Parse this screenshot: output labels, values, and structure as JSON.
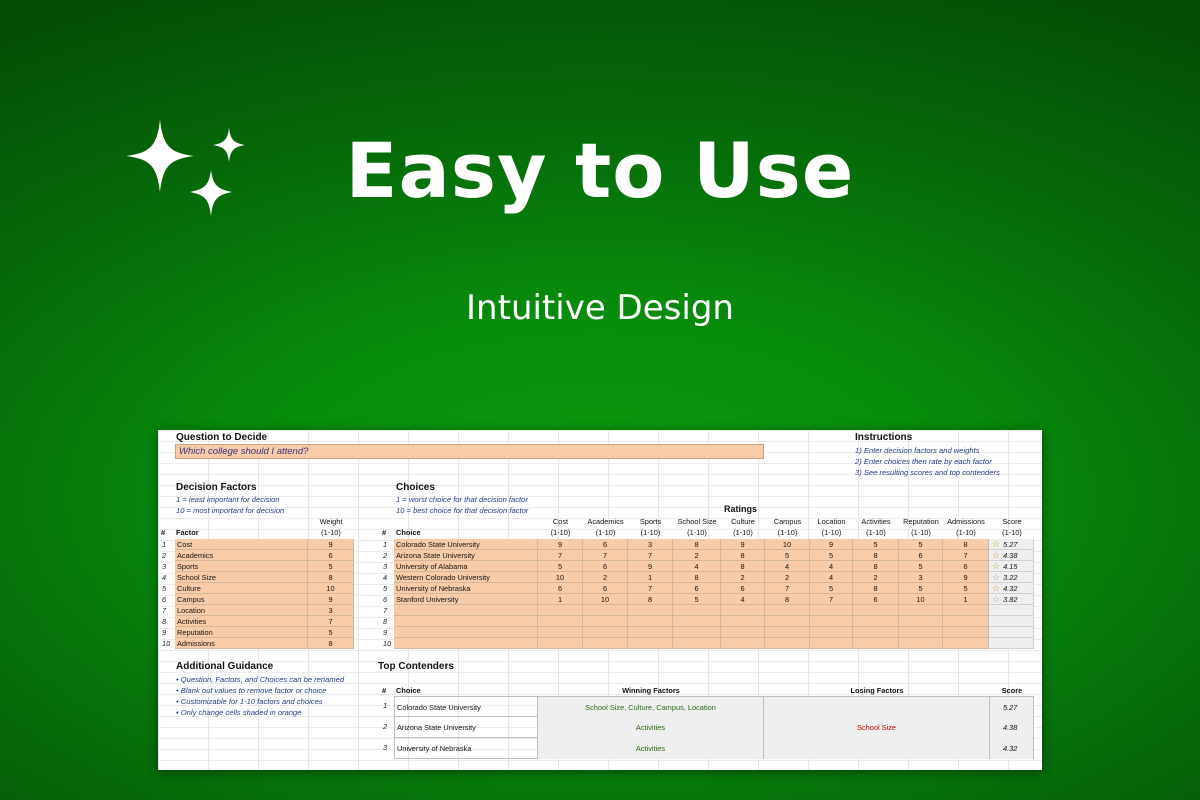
{
  "hero": {
    "title": "Easy to Use",
    "subtitle": "Intuitive Design",
    "icon": "sparkles-icon"
  },
  "question": {
    "heading": "Question to Decide",
    "value": "Which college should I attend?"
  },
  "instructions": {
    "heading": "Instructions",
    "steps": [
      "1) Enter decision factors and weights",
      "2) Enter choices then rate by each factor",
      "3) See resulting scores and top contenders"
    ]
  },
  "factors": {
    "heading": "Decision Factors",
    "notes": [
      "1 = least important for decision",
      "10 = most important for decision"
    ],
    "col_num": "#",
    "col_factor": "Factor",
    "col_weight_1": "Weight",
    "col_weight_2": "(1-10)",
    "rows": [
      {
        "n": "1",
        "name": "Cost",
        "weight": "9"
      },
      {
        "n": "2",
        "name": "Academics",
        "weight": "6"
      },
      {
        "n": "3",
        "name": "Sports",
        "weight": "5"
      },
      {
        "n": "4",
        "name": "School Size",
        "weight": "8"
      },
      {
        "n": "5",
        "name": "Culture",
        "weight": "10"
      },
      {
        "n": "6",
        "name": "Campus",
        "weight": "9"
      },
      {
        "n": "7",
        "name": "Location",
        "weight": "3"
      },
      {
        "n": "8",
        "name": "Activities",
        "weight": "7"
      },
      {
        "n": "9",
        "name": "Reputation",
        "weight": "5"
      },
      {
        "n": "10",
        "name": "Admissions",
        "weight": "8"
      }
    ]
  },
  "choices": {
    "heading": "Choices",
    "notes": [
      "1 = worst choice for that decision factor",
      "10 = best choice for that decision factor"
    ],
    "ratings_heading": "Ratings",
    "col_num": "#",
    "col_choice": "Choice",
    "factor_cols": [
      "Cost",
      "Academics",
      "Sports",
      "School Size",
      "Culture",
      "Campus",
      "Location",
      "Activities",
      "Reputation",
      "Admissions"
    ],
    "range_label": "(1-10)",
    "score_label": "Score",
    "score_range": "(1-10)",
    "rows": [
      {
        "n": "1",
        "name": "Colorado State University",
        "ratings": [
          "9",
          "6",
          "3",
          "8",
          "9",
          "10",
          "9",
          "5",
          "5",
          "8"
        ],
        "score": "5.27",
        "star": "gold"
      },
      {
        "n": "2",
        "name": "Arizona State University",
        "ratings": [
          "7",
          "7",
          "7",
          "2",
          "8",
          "5",
          "5",
          "8",
          "6",
          "7"
        ],
        "score": "4.38",
        "star": "gold"
      },
      {
        "n": "3",
        "name": "University of Alabama",
        "ratings": [
          "5",
          "6",
          "9",
          "4",
          "8",
          "4",
          "4",
          "8",
          "5",
          "6"
        ],
        "score": "4.15",
        "star": "gold"
      },
      {
        "n": "4",
        "name": "Western Colorado University",
        "ratings": [
          "10",
          "2",
          "1",
          "8",
          "2",
          "2",
          "4",
          "2",
          "3",
          "9"
        ],
        "score": "3.22",
        "star": "grey"
      },
      {
        "n": "5",
        "name": "University of Nebraska",
        "ratings": [
          "6",
          "6",
          "7",
          "6",
          "6",
          "7",
          "5",
          "8",
          "5",
          "5"
        ],
        "score": "4.32",
        "star": "gold"
      },
      {
        "n": "6",
        "name": "Stanford University",
        "ratings": [
          "1",
          "10",
          "8",
          "5",
          "4",
          "8",
          "7",
          "6",
          "10",
          "1"
        ],
        "score": "3.82",
        "star": "grey"
      },
      {
        "n": "7",
        "name": "",
        "ratings": [
          "",
          "",
          "",
          "",
          "",
          "",
          "",
          "",
          "",
          ""
        ],
        "score": "",
        "star": ""
      },
      {
        "n": "8",
        "name": "",
        "ratings": [
          "",
          "",
          "",
          "",
          "",
          "",
          "",
          "",
          "",
          ""
        ],
        "score": "",
        "star": ""
      },
      {
        "n": "9",
        "name": "",
        "ratings": [
          "",
          "",
          "",
          "",
          "",
          "",
          "",
          "",
          "",
          ""
        ],
        "score": "",
        "star": ""
      },
      {
        "n": "10",
        "name": "",
        "ratings": [
          "",
          "",
          "",
          "",
          "",
          "",
          "",
          "",
          "",
          ""
        ],
        "score": "",
        "star": ""
      }
    ]
  },
  "guidance": {
    "heading": "Additional Guidance",
    "items": [
      "• Question, Factors, and Choices can be renamed",
      "• Blank out values to remove factor or choice",
      "• Customizable for 1-10 factors and choices",
      "• Only change cells shaded in orange"
    ]
  },
  "contenders": {
    "heading": "Top Contenders",
    "col_num": "#",
    "col_choice": "Choice",
    "col_winning": "Winning Factors",
    "col_losing": "Losing Factors",
    "col_score": "Score",
    "rows": [
      {
        "n": "1",
        "name": "Colorado State University",
        "winning": "School Size, Culture, Campus, Location",
        "losing": "",
        "score": "5.27"
      },
      {
        "n": "2",
        "name": "Arizona State University",
        "winning": "Activities",
        "losing": "School Size",
        "score": "4.38"
      },
      {
        "n": "3",
        "name": "University of Nebraska",
        "winning": "Activities",
        "losing": "",
        "score": "4.32"
      }
    ]
  }
}
